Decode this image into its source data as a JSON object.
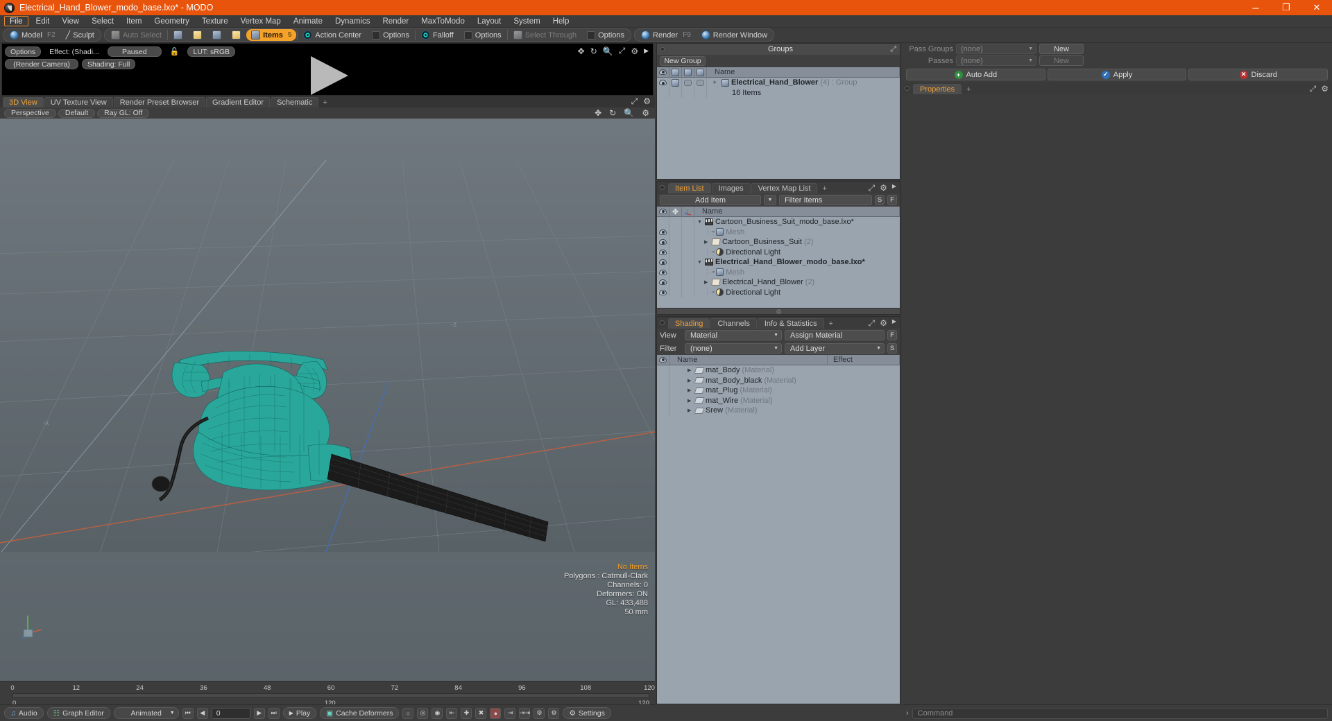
{
  "window": {
    "title": "Electrical_Hand_Blower_modo_base.lxo* - MODO",
    "minimize": "─",
    "maximize": "❐",
    "close": "✕"
  },
  "menubar": {
    "items": [
      "File",
      "Edit",
      "View",
      "Select",
      "Item",
      "Geometry",
      "Texture",
      "Vertex Map",
      "Animate",
      "Dynamics",
      "Render",
      "MaxToModo",
      "Layout",
      "System",
      "Help"
    ],
    "active": "File"
  },
  "modebar": {
    "model": "Model",
    "model_key": "F2",
    "sculpt": "Sculpt",
    "auto_select": "Auto Select",
    "items": "Items",
    "items_key": "5",
    "action_center": "Action Center",
    "options1": "Options",
    "falloff": "Falloff",
    "options2": "Options",
    "select_through": "Select Through",
    "options3": "Options",
    "render": "Render",
    "render_key": "F9",
    "render_window": "Render Window"
  },
  "preview": {
    "options": "Options",
    "effect": "Effect: (Shadi...",
    "paused": "Paused",
    "lut": "LUT: sRGB",
    "render_camera": "(Render Camera)",
    "shading": "Shading: Full"
  },
  "viewport": {
    "tabs": [
      "3D View",
      "UV Texture View",
      "Render Preset Browser",
      "Gradient Editor",
      "Schematic"
    ],
    "active_tab": "3D View",
    "plus": "+",
    "chips": [
      "Perspective",
      "Default",
      "Ray GL: Off"
    ],
    "stats": {
      "no_items": "No Items",
      "polygons": "Polygons : Catmull-Clark",
      "channels": "Channels: 0",
      "deformers": "Deformers: ON",
      "gl": "GL: 433,488",
      "scale": "50 mm"
    }
  },
  "timeline": {
    "ticks": [
      "0",
      "12",
      "24",
      "36",
      "48",
      "60",
      "72",
      "84",
      "96",
      "108",
      "120"
    ],
    "range_start": "0",
    "range_mid": "120",
    "range_end": "120"
  },
  "bottombar": {
    "audio": "Audio",
    "graph_editor": "Graph Editor",
    "animated": "Animated",
    "frame_value": "0",
    "play": "Play",
    "cache_deformers": "Cache Deformers",
    "settings": "Settings"
  },
  "groups_panel": {
    "title": "Groups",
    "new_group_button": "New Group",
    "columns": [
      "eye-col",
      "render-col",
      "box-col",
      "box2-col",
      "Name"
    ],
    "name_column": "Name",
    "rows": [
      {
        "name": "Electrical_Hand_Blower",
        "count": "(4)",
        "type": ": Group",
        "sub": "16 Items",
        "expander": "+"
      }
    ]
  },
  "item_list": {
    "tabs": [
      "Item List",
      "Images",
      "Vertex Map List"
    ],
    "active_tab": "Item List",
    "plus": "+",
    "add_item": "Add Item",
    "filter_items": "Filter Items",
    "btn_s": "S",
    "btn_f": "F",
    "name_column": "Name",
    "rows": [
      {
        "indent": 0,
        "twisty": "▼",
        "icon": "slate-icon",
        "label": "Cartoon_Business_Suit_modo_base.lxo*",
        "suffix": "",
        "muted": false,
        "bold": false,
        "eye": false
      },
      {
        "indent": 1,
        "twisty": "",
        "icon": "cube-icon",
        "label": "Mesh",
        "suffix": "",
        "muted": true,
        "bold": false,
        "eye": true
      },
      {
        "indent": 1,
        "twisty": "▶",
        "icon": "folder-icon",
        "label": "Cartoon_Business_Suit",
        "suffix": "(2)",
        "muted": false,
        "bold": false,
        "eye": true
      },
      {
        "indent": 1,
        "twisty": "",
        "icon": "light-icon",
        "label": "Directional Light",
        "suffix": "",
        "muted": false,
        "bold": false,
        "eye": true
      },
      {
        "indent": 0,
        "twisty": "▼",
        "icon": "slate-icon",
        "label": "Electrical_Hand_Blower_modo_base.lxo*",
        "suffix": "",
        "muted": false,
        "bold": true,
        "eye": true
      },
      {
        "indent": 1,
        "twisty": "",
        "icon": "cube-icon",
        "label": "Mesh",
        "suffix": "",
        "muted": true,
        "bold": false,
        "eye": true
      },
      {
        "indent": 1,
        "twisty": "▶",
        "icon": "folder-icon",
        "label": "Electrical_Hand_Blower",
        "suffix": "(2)",
        "muted": false,
        "bold": false,
        "eye": true
      },
      {
        "indent": 1,
        "twisty": "",
        "icon": "light-icon",
        "label": "Directional Light",
        "suffix": "",
        "muted": false,
        "bold": false,
        "eye": true
      }
    ]
  },
  "shading_panel": {
    "tabs": [
      "Shading",
      "Channels",
      "Info & Statistics"
    ],
    "active_tab": "Shading",
    "plus": "+",
    "view_label": "View",
    "view_value": "Material",
    "assign_material": "Assign Material",
    "filter_label": "Filter",
    "filter_value": "(none)",
    "add_layer": "Add Layer",
    "btn_f": "F",
    "btn_s": "S",
    "name_column": "Name",
    "effect_column": "Effect",
    "rows": [
      {
        "label": "mat_Body",
        "type": "(Material)"
      },
      {
        "label": "mat_Body_black",
        "type": "(Material)"
      },
      {
        "label": "mat_Plug",
        "type": "(Material)"
      },
      {
        "label": "mat_Wire",
        "type": "(Material)"
      },
      {
        "label": "Srew",
        "type": "(Material)"
      }
    ]
  },
  "properties_panel": {
    "pass_groups_label": "Pass Groups",
    "pass_groups_value": "(none)",
    "new_button_1": "New",
    "passes_label": "Passes",
    "passes_value": "(none)",
    "new_button_2": "New",
    "auto_add": "Auto Add",
    "apply": "Apply",
    "discard": "Discard",
    "tab_properties": "Properties",
    "plus": "+"
  },
  "command_bar": {
    "prompt": "›",
    "placeholder": "Command"
  },
  "colors": {
    "title_bar": "#e8540c",
    "accent_orange": "#f5a22a",
    "tab_active_text": "#f0a13a",
    "panel_bg": "#3f3f3f",
    "list_bg": "#9aa4ae",
    "model_teal": "#2aa79b"
  }
}
